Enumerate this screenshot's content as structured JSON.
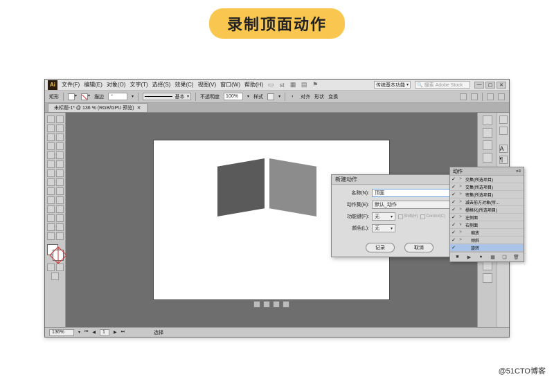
{
  "page_title": "录制顶面动作",
  "watermark": "@51CTO博客",
  "menubar": {
    "items": [
      "文件(F)",
      "编辑(E)",
      "对象(O)",
      "文字(T)",
      "选择(S)",
      "效果(C)",
      "视图(V)",
      "窗口(W)",
      "帮助(H)"
    ],
    "workspace_label": "传统基本功能",
    "search_placeholder": "搜索 Adobe Stock"
  },
  "optionbar": {
    "label_left": "矩形",
    "stroke_label": "描边",
    "basic": "基本",
    "opacity_label": "不透明度",
    "opacity_value": "100%",
    "style_label": "样式",
    "align": "对齐",
    "shape": "形状",
    "transform": "变换"
  },
  "document": {
    "tab_title": "未标题-1* @ 136 % (RGB/GPU 预览)"
  },
  "status": {
    "zoom": "136%",
    "tool": "选择"
  },
  "dialog": {
    "title": "新建动作",
    "name_label": "名称(N):",
    "name_value": "顶面",
    "set_label": "动作集(E):",
    "set_value": "默认_动作",
    "fkey_label": "功能键(F):",
    "fkey_value": "无",
    "shift": "Shift(H)",
    "ctrl": "Control(C)",
    "color_label": "颜色(L):",
    "color_value": "无",
    "record": "记录",
    "cancel": "取消"
  },
  "actions_panel": {
    "header": "动作",
    "items": [
      {
        "label": "交集(所选项目)",
        "expand": ">",
        "checked": true
      },
      {
        "label": "交集(所选项目)",
        "expand": ">",
        "checked": true
      },
      {
        "label": "密集(所选项目)",
        "expand": ">",
        "checked": true
      },
      {
        "label": "减去前方对象(所...",
        "expand": ">",
        "checked": true
      },
      {
        "label": "栅格化(所选项目)",
        "expand": ">",
        "checked": true
      },
      {
        "label": "左侧面",
        "expand": ">",
        "checked": true
      },
      {
        "label": "右侧面",
        "expand": "v",
        "checked": true
      },
      {
        "label": "缩放",
        "expand": ">",
        "checked": true,
        "indent": 1
      },
      {
        "label": "倾斜",
        "expand": ">",
        "checked": true,
        "indent": 1
      },
      {
        "label": "旋转",
        "expand": "",
        "checked": true,
        "indent": 1,
        "highlight": true
      }
    ],
    "footer_icons": [
      "■",
      "▶",
      "●",
      "▦",
      "❏",
      "🗑"
    ]
  }
}
